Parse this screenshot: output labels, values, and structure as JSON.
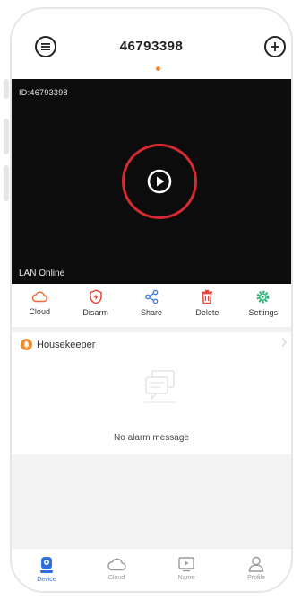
{
  "header": {
    "title": "46793398",
    "menu_icon": "list-circle-icon",
    "add_icon": "plus-circle-icon"
  },
  "video": {
    "device_id": "ID:46793398",
    "status": "LAN Online",
    "play_icon": "play-circle-icon"
  },
  "toolbar": {
    "items": [
      {
        "label": "Cloud",
        "icon": "cloud-icon",
        "color": "#f06a3c"
      },
      {
        "label": "Disarm",
        "icon": "shield-icon",
        "color": "#e8483c"
      },
      {
        "label": "Share",
        "icon": "share-icon",
        "color": "#3d7fe0"
      },
      {
        "label": "Delete",
        "icon": "trash-icon",
        "color": "#e8483c"
      },
      {
        "label": "Settings",
        "icon": "gear-icon",
        "color": "#2fb37a"
      }
    ]
  },
  "housekeeper": {
    "label": "Housekeeper",
    "empty_message": "No alarm message"
  },
  "tabbar": {
    "tabs": [
      {
        "label": "Device",
        "icon": "camera-icon",
        "active": true
      },
      {
        "label": "Cloud",
        "icon": "cloud-icon",
        "active": false
      },
      {
        "label": "Name",
        "icon": "video-icon",
        "active": false
      },
      {
        "label": "Profile",
        "icon": "person-icon",
        "active": false
      }
    ]
  },
  "colors": {
    "accent": "#2f6fdc",
    "play_ring": "#d62a33",
    "housekeeper": "#f08a2a",
    "page_dot": "#f08a2a"
  }
}
